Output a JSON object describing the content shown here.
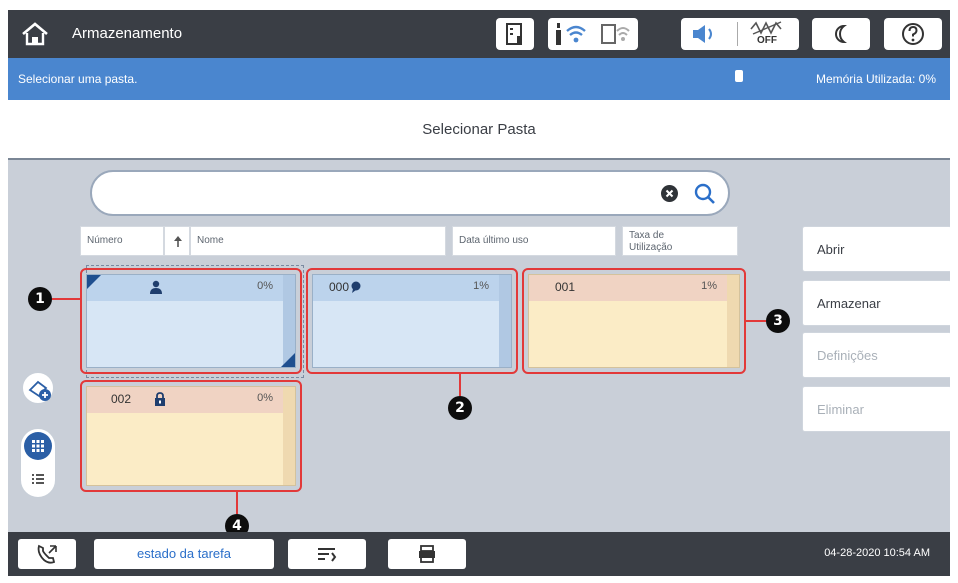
{
  "topbar": {
    "title": "Armazenamento",
    "icons": [
      "home-icon",
      "printer-status-icon",
      "wifi-icon",
      "wifi-direct-icon",
      "speaker-icon",
      "quiet-mode-off-icon",
      "sleep-moon-icon",
      "help-icon"
    ],
    "quiet_label": "OFF"
  },
  "infobar": {
    "prompt": "Selecionar uma pasta.",
    "memory": "Memória Utilizada: 0%"
  },
  "header": {
    "title": "Selecionar Pasta"
  },
  "search": {
    "value": "",
    "placeholder": ""
  },
  "columns": {
    "number": "Número",
    "name": "Nome",
    "last_used": "Data último uso",
    "usage_line1": "Taxa de",
    "usage_line2": "Utilização"
  },
  "folders": [
    {
      "number": "",
      "icon": "user-icon",
      "usage": "0%",
      "color": "blue"
    },
    {
      "number": "000",
      "icon": "comment-icon",
      "usage": "1%",
      "color": "blue"
    },
    {
      "number": "001",
      "icon": "",
      "usage": "1%",
      "color": "yellow"
    },
    {
      "number": "002",
      "icon": "lock-icon",
      "usage": "0%",
      "color": "yellow"
    }
  ],
  "callouts": [
    "1",
    "2",
    "3",
    "4"
  ],
  "actions": {
    "open": "Abrir",
    "store": "Armazenar",
    "settings": "Definições",
    "delete": "Eliminar"
  },
  "bottombar": {
    "job_status": "estado da tarefa",
    "datetime": "04-28-2020 10:54 AM"
  },
  "colors": {
    "accent": "#4a86cf",
    "highlight": "#e23939",
    "bar_dark": "#3a3e45"
  }
}
